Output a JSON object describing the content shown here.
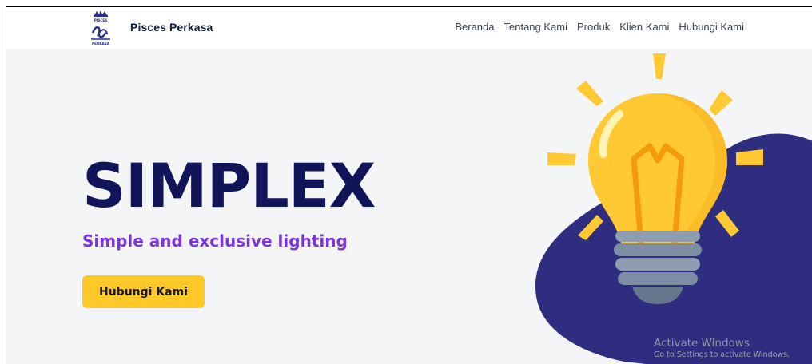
{
  "header": {
    "brand": "Pisces Perkasa",
    "logo_text": "PISCES PERKASA"
  },
  "nav": {
    "items": [
      {
        "label": "Beranda"
      },
      {
        "label": "Tentang Kami"
      },
      {
        "label": "Produk"
      },
      {
        "label": "Klien Kami"
      },
      {
        "label": "Hubungi Kami"
      }
    ]
  },
  "hero": {
    "title": "SIMPLEX",
    "subtitle": "Simple and exclusive lighting",
    "cta_label": "Hubungi Kami"
  },
  "watermark": {
    "title": "Activate Windows",
    "subtitle": "Go to Settings to activate Windows."
  },
  "colors": {
    "title": "#12145a",
    "subtitle": "#7b35d8",
    "cta": "#ffc829",
    "blob": "#2e2d7f",
    "bulb": "#ffc933",
    "filament": "#f59a0b",
    "socket": "#8e9db0"
  },
  "icons": {
    "logo": "pisces-logo",
    "illustration": "lightbulb-icon"
  }
}
